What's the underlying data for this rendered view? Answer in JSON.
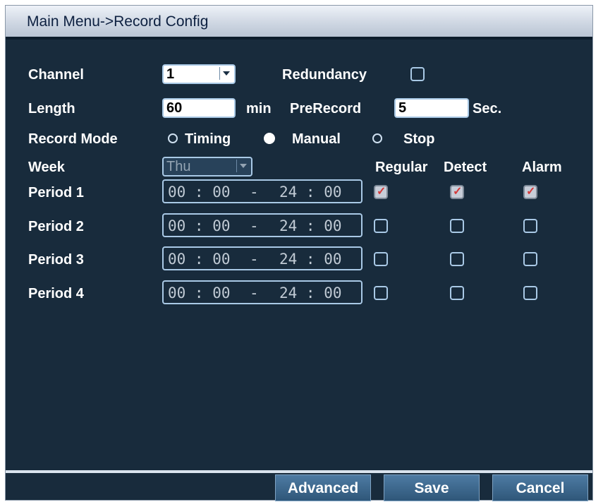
{
  "title": "Main Menu->Record Config",
  "channel": {
    "label": "Channel",
    "value": "1"
  },
  "redundancy": {
    "label": "Redundancy",
    "checked": false
  },
  "length": {
    "label": "Length",
    "value": "60",
    "unit": "min"
  },
  "prerecord": {
    "label": "PreRecord",
    "value": "5",
    "unit": "Sec."
  },
  "record_mode": {
    "label": "Record Mode",
    "options": [
      "Timing",
      "Manual",
      "Stop"
    ],
    "selected": "Manual"
  },
  "week": {
    "label": "Week",
    "value": "Thu"
  },
  "columns": [
    "Regular",
    "Detect",
    "Alarm"
  ],
  "periods": [
    {
      "label": "Period 1",
      "start": "00 : 00",
      "sep": "-",
      "end": "24 : 00",
      "regular": true,
      "detect": true,
      "alarm": true
    },
    {
      "label": "Period 2",
      "start": "00 : 00",
      "sep": "-",
      "end": "24 : 00",
      "regular": false,
      "detect": false,
      "alarm": false
    },
    {
      "label": "Period 3",
      "start": "00 : 00",
      "sep": "-",
      "end": "24 : 00",
      "regular": false,
      "detect": false,
      "alarm": false
    },
    {
      "label": "Period 4",
      "start": "00 : 00",
      "sep": "-",
      "end": "24 : 00",
      "regular": false,
      "detect": false,
      "alarm": false
    }
  ],
  "buttons": {
    "advanced": "Advanced",
    "save": "Save",
    "cancel": "Cancel"
  }
}
